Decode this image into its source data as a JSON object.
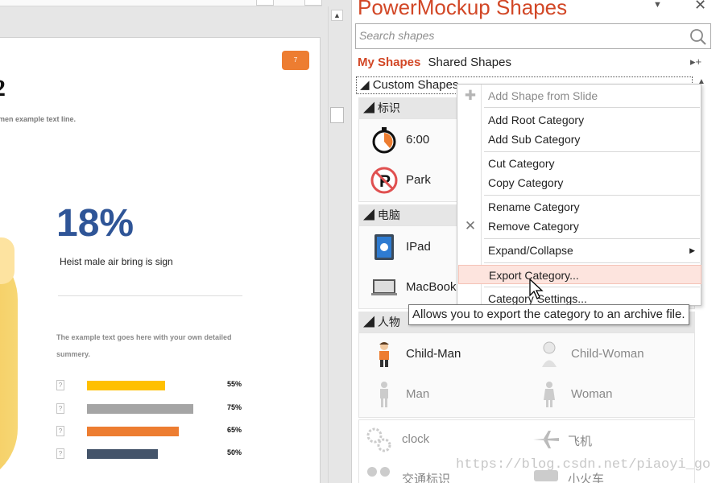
{
  "slide": {
    "number": "2",
    "subtitle": "men example text line.",
    "badge": "7",
    "big_percent": "18%",
    "tagline": "Heist male air bring is sign",
    "description": "The example text goes here with your own detailed summery.",
    "bars": [
      {
        "value": 0.55,
        "label": "55%",
        "color": "#ffc000"
      },
      {
        "value": 0.75,
        "label": "75%",
        "color": "#a5a5a5"
      },
      {
        "value": 0.65,
        "label": "65%",
        "color": "#ed7d31"
      },
      {
        "value": 0.5,
        "label": "50%",
        "color": "#44546a"
      }
    ],
    "placeholder_glyph": "?"
  },
  "pane": {
    "title": "PowerMockup Shapes",
    "dropdown_glyph": "▼",
    "close_glyph": "✕",
    "search_placeholder": "Search shapes",
    "tab_my": "My Shapes",
    "tab_shared": "Shared Shapes",
    "tab_controls": "▸+",
    "root_category": "Custom Shapes",
    "scroll_up_glyph": "▲",
    "categories": [
      {
        "name": "标识",
        "shapes": [
          "6:00",
          "Park"
        ]
      },
      {
        "name": "电脑",
        "shapes": [
          "IPad",
          "MacBook"
        ]
      },
      {
        "name": "人物",
        "shapes": [
          "Child-Man",
          "Child-Woman",
          "Man",
          "Woman"
        ]
      }
    ],
    "more_shapes": [
      "clock",
      "飞机",
      "交通标识",
      "小火车"
    ],
    "accent_color": "#d24726"
  },
  "context_menu": {
    "items": [
      {
        "label": "Add Shape from Slide",
        "disabled": true,
        "icon": "plus-icon"
      },
      {
        "label": "Add Root Category"
      },
      {
        "label": "Add Sub Category"
      },
      {
        "label": "Cut Category"
      },
      {
        "label": "Copy Category"
      },
      {
        "label": "Rename Category"
      },
      {
        "label": "Remove Category",
        "icon": "x-icon"
      },
      {
        "label": "Expand/Collapse",
        "submenu": true
      },
      {
        "label": "Export Category...",
        "hover": true
      },
      {
        "label": "Category Settings..."
      }
    ],
    "icon_glyphs": {
      "plus": "✚",
      "x": "✕",
      "submenu": "▶"
    }
  },
  "tooltip": "Allows you to export the category to an archive file.",
  "watermark": "https://blog.csdn.net/piaoyi_go",
  "scrollbar_arrow": "▲"
}
